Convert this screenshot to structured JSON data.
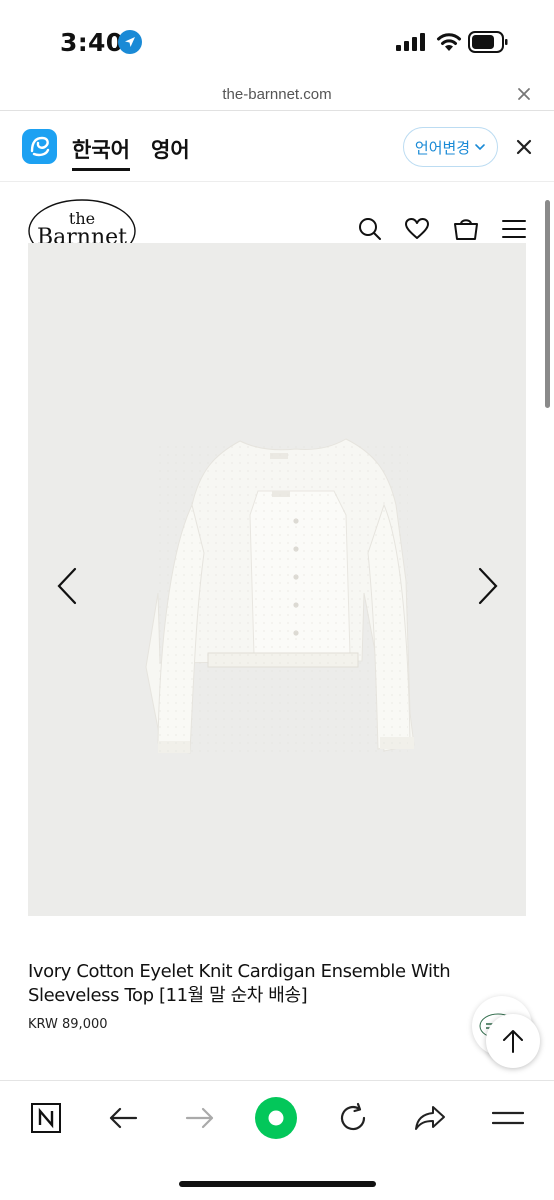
{
  "status": {
    "time": "3:40"
  },
  "browser": {
    "url": "the-barnnet.com"
  },
  "translate": {
    "current_lang": "한국어",
    "other_lang": "영어",
    "change_label": "언어변경",
    "accent_color": "#1a8ad6"
  },
  "site": {
    "logo_top": "the",
    "logo_main": "Barnnet"
  },
  "product": {
    "title": "Ivory Cotton Eyelet Knit Cardigan Ensemble With Sleeveless Top [11월 말 순차 배송]",
    "price": "KRW 89,000"
  },
  "icons": {
    "header": [
      "search-icon",
      "heart-icon",
      "cart-icon",
      "menu-icon"
    ],
    "toolbar": [
      "naver-icon",
      "back-icon",
      "forward-icon",
      "green-dot-icon",
      "reload-icon",
      "share-icon",
      "menu-icon"
    ]
  }
}
